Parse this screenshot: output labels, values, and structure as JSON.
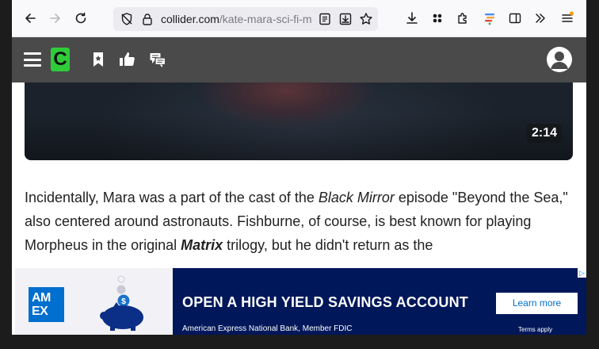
{
  "browser": {
    "url_host": "collider.com",
    "url_path": "/kate-mara-sci-fi-m"
  },
  "video": {
    "duration": "2:14"
  },
  "article": {
    "p1": "Incidentally, Mara was a part of the cast of the ",
    "em1": "Black Mirror",
    "p2": " episode \"Beyond the Sea,\" also centered around astronauts. Fishburne, of course, is best known for playing Morpheus in the original ",
    "strong1": "Matrix",
    "p3": " trilogy, but he didn't return as the"
  },
  "ad": {
    "logo_line1": "AM",
    "logo_line2": "EX",
    "headline": "OPEN A HIGH YIELD SAVINGS ACCOUNT",
    "subline": "American Express National Bank, Member FDIC",
    "cta": "Learn more",
    "terms": "Terms apply",
    "piggy_symbol": "$",
    "brand_blue": "#006fcf",
    "navy": "#00175a"
  },
  "header": {
    "logo_letter": "C",
    "logo_color": "#2fcc3a"
  }
}
